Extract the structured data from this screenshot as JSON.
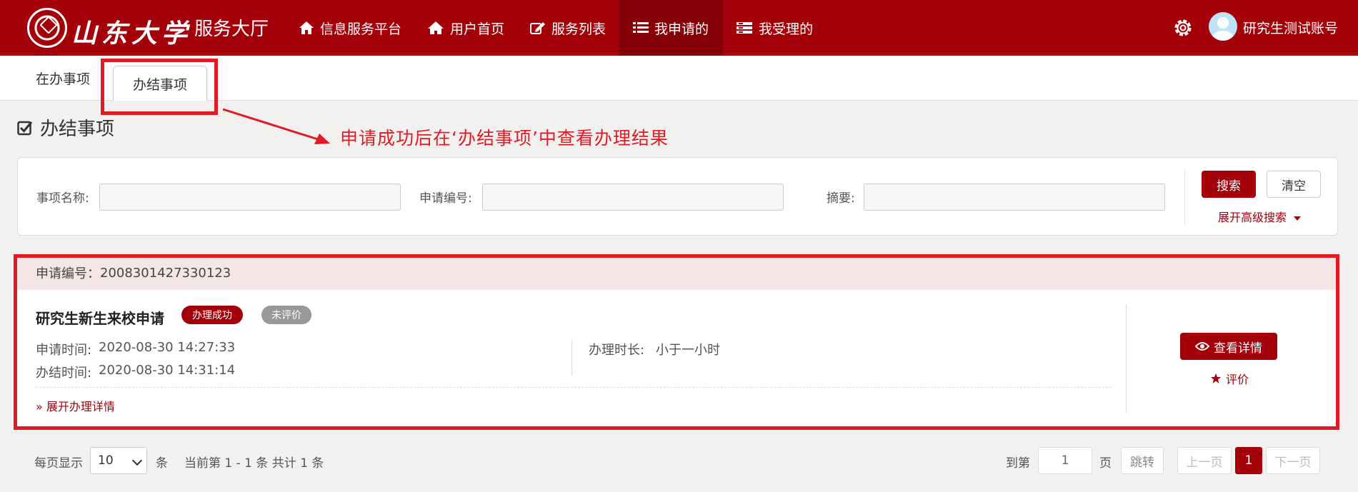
{
  "header": {
    "logo_text": "山东大学",
    "logo_dot": "·",
    "logo_sub": "服务大厅",
    "nav": [
      {
        "label": "信息服务平台",
        "icon": "home-icon"
      },
      {
        "label": "用户首页",
        "icon": "house-icon"
      },
      {
        "label": "服务列表",
        "icon": "edit-icon"
      },
      {
        "label": "我申请的",
        "icon": "list-icon",
        "active": true
      },
      {
        "label": "我受理的",
        "icon": "inbox-icon"
      }
    ],
    "username": "研究生测试账号"
  },
  "tabs": [
    {
      "label": "在办事项"
    },
    {
      "label": "办结事项",
      "active": true
    }
  ],
  "section": {
    "title": "办结事项",
    "annotation": "申请成功后在‘办结事项’中查看办理结果"
  },
  "search": {
    "name_label": "事项名称:",
    "number_label": "申请编号:",
    "summary_label": "摘要:",
    "search_button": "搜索",
    "clear_button": "清空",
    "advanced": "展开高级搜索"
  },
  "application": {
    "number_label": "申请编号：",
    "number": "2008301427330123",
    "title": "研究生新生来校申请",
    "status_badge": "办理成功",
    "rating_badge": "未评价",
    "apply_time_label": "申请时间:",
    "apply_time": "2020-08-30 14:27:33",
    "done_time_label": "办结时间:",
    "done_time": "2020-08-30 14:31:14",
    "duration_label": "办理时长:",
    "duration": "小于一小时",
    "expand": "展开办理详情",
    "detail_button": "查看详情",
    "rate_link": "评价"
  },
  "pagination": {
    "per_page_label": "每页显示",
    "per_page_value": "10",
    "unit": "条",
    "summary": "当前第 1 - 1 条 共计 1 条",
    "goto_label": "到第",
    "goto_value": "1",
    "page_label": "页",
    "jump_button": "跳转",
    "prev": "上一页",
    "current": "1",
    "next": "下一页"
  },
  "colors": {
    "brand": "#a3000a",
    "annotation": "#e01b25"
  }
}
